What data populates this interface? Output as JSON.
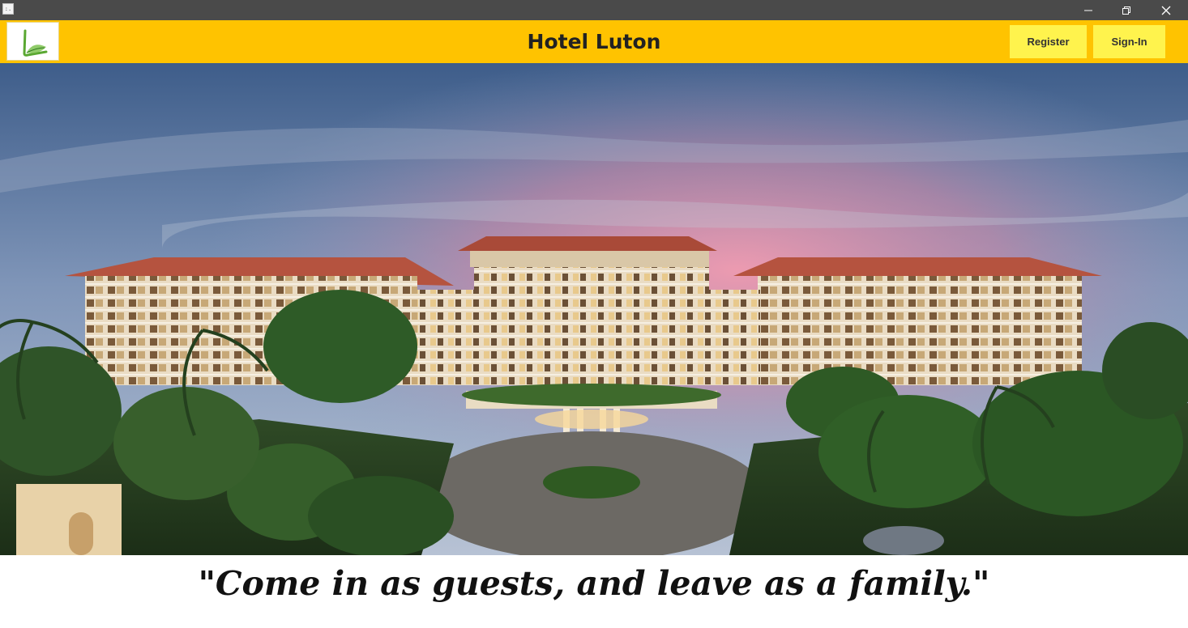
{
  "window": {
    "app_icon": "app-icon",
    "minimize_icon": "minimize-icon",
    "maximize_icon": "restore-icon",
    "close_icon": "close-icon"
  },
  "header": {
    "logo": "hotel-logo",
    "title": "Hotel Luton",
    "register_label": "Register",
    "signin_label": "Sign-In"
  },
  "hero": {
    "image": "hotel-building-photo"
  },
  "quote": {
    "text": "\"Come in as guests, and leave as a family.\""
  },
  "colors": {
    "titlebar": "#4a4a4a",
    "header_bg": "#ffc300",
    "button_bg": "#fff34d",
    "logo_green": "#5aa832",
    "text_dark": "#222222"
  }
}
